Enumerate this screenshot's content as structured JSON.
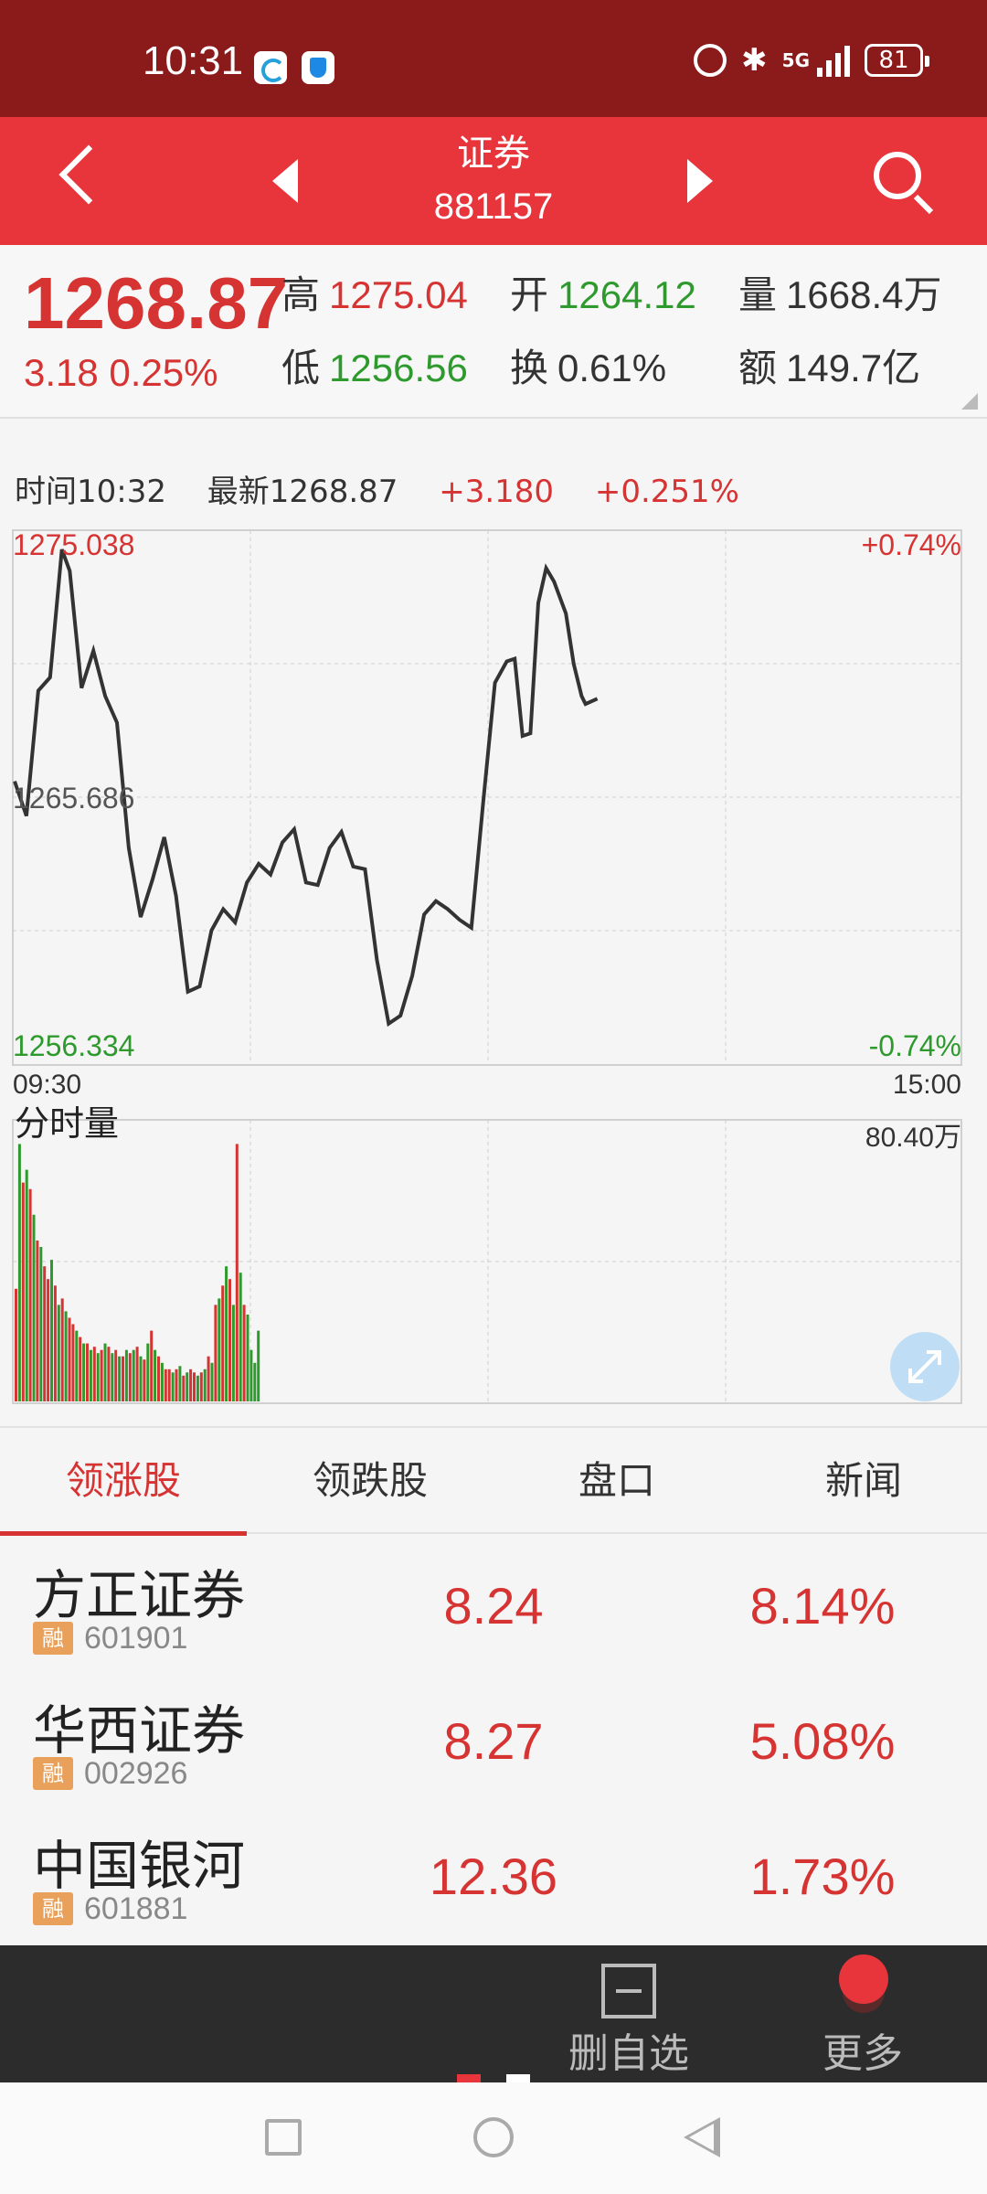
{
  "status_bar": {
    "time": "10:31",
    "network": "5G",
    "battery": "81"
  },
  "header": {
    "title": "证券",
    "code": "881157"
  },
  "quote": {
    "price": "1268.87",
    "change": "3.18 0.25%",
    "high_label": "高",
    "high": "1275.04",
    "open_label": "开",
    "open": "1264.12",
    "volume_label": "量",
    "volume": "1668.4万",
    "low_label": "低",
    "low": "1256.56",
    "turnover_label": "换",
    "turnover": "0.61%",
    "amount_label": "额",
    "amount": "149.7亿"
  },
  "info_line": {
    "time": "时间10:32",
    "latest": "最新1268.87",
    "change": "+3.180",
    "change_pct": "+0.251%"
  },
  "colors": {
    "up": "#d63333",
    "down": "#2e9a2e",
    "header_bg": "#e8353b",
    "status_bg": "#8b1a1a"
  },
  "chart_data": [
    {
      "type": "line",
      "title": "",
      "y_max_label": "1275.038",
      "y_mid_label": "1265.686",
      "y_min_label": "1256.334",
      "pct_max_label": "+0.74%",
      "pct_min_label": "-0.74%",
      "x_start_label": "09:30",
      "x_end_label": "15:00",
      "ylim": [
        1256.334,
        1275.038
      ],
      "xlim": [
        0,
        240
      ],
      "grid": true,
      "series": [
        {
          "x": [
            0,
            3,
            6,
            9,
            12,
            14,
            17,
            20,
            23,
            26,
            29,
            32,
            35,
            38,
            41,
            44,
            47,
            50,
            53,
            56,
            59,
            62,
            65,
            68,
            71,
            74,
            77,
            80,
            83,
            86,
            89,
            92,
            95,
            98,
            101,
            104,
            107,
            110,
            113,
            116,
            119,
            122,
            125,
            127,
            129,
            131,
            133,
            135,
            137,
            138,
            140,
            142,
            144,
            145,
            148
          ],
          "values": [
            1266.3,
            1265.0,
            1269.7,
            1270.2,
            1275.0,
            1274.2,
            1269.8,
            1271.2,
            1269.5,
            1268.5,
            1263.8,
            1261.2,
            1262.6,
            1264.2,
            1262.0,
            1258.4,
            1258.6,
            1260.7,
            1261.5,
            1261.0,
            1262.5,
            1263.2,
            1262.8,
            1264.0,
            1264.5,
            1262.5,
            1262.4,
            1263.8,
            1264.4,
            1263.1,
            1263.0,
            1259.6,
            1257.2,
            1257.5,
            1259.0,
            1261.3,
            1261.8,
            1261.5,
            1261.1,
            1260.8,
            1265.5,
            1270.0,
            1270.8,
            1270.9,
            1268.0,
            1268.1,
            1273.0,
            1274.3,
            1273.8,
            1273.4,
            1272.6,
            1270.7,
            1269.5,
            1269.2,
            1269.4
          ]
        }
      ]
    },
    {
      "type": "bar",
      "title": "分时量",
      "y_max_label": "80.40万",
      "ylim": [
        0,
        80.4
      ],
      "colors_up_down": [
        "#d63333",
        "#2e9a2e"
      ],
      "values": [
        35,
        80,
        68,
        72,
        66,
        58,
        50,
        48,
        42,
        38,
        44,
        36,
        30,
        32,
        28,
        26,
        24,
        22,
        20,
        18,
        18,
        16,
        17,
        15,
        16,
        18,
        17,
        15,
        16,
        14,
        14,
        16,
        15,
        16,
        17,
        14,
        13,
        18,
        22,
        16,
        14,
        12,
        10,
        10,
        9,
        10,
        11,
        8,
        9,
        10,
        9,
        8,
        9,
        10,
        14,
        12,
        30,
        32,
        36,
        42,
        38,
        30,
        80,
        40,
        30,
        27,
        16,
        12,
        22
      ],
      "up": [
        1,
        0,
        1,
        0,
        1,
        0,
        1,
        0,
        1,
        1,
        0,
        1,
        0,
        1,
        0,
        1,
        1,
        0,
        1,
        0,
        1,
        0,
        1,
        0,
        1,
        0,
        1,
        0,
        1,
        0,
        1,
        0,
        1,
        0,
        1,
        0,
        1,
        0,
        1,
        0,
        1,
        0,
        1,
        1,
        0,
        1,
        0,
        1,
        0,
        1,
        1,
        0,
        1,
        0,
        1,
        0,
        1,
        0,
        1,
        0,
        1,
        0,
        1,
        0,
        1,
        0,
        0,
        0,
        0
      ]
    }
  ],
  "tabs": [
    {
      "label": "领涨股",
      "active": true
    },
    {
      "label": "领跌股",
      "active": false
    },
    {
      "label": "盘口",
      "active": false
    },
    {
      "label": "新闻",
      "active": false
    }
  ],
  "stocks": [
    {
      "name": "方正证券",
      "badge": "融",
      "code": "601901",
      "price": "8.24",
      "pct": "8.14%"
    },
    {
      "name": "华西证券",
      "badge": "融",
      "code": "002926",
      "price": "8.27",
      "pct": "5.08%"
    },
    {
      "name": "中国银河",
      "badge": "融",
      "code": "601881",
      "price": "12.36",
      "pct": "1.73%"
    }
  ],
  "toolbar": {
    "delete_label": "删自选",
    "more_label": "更多"
  }
}
